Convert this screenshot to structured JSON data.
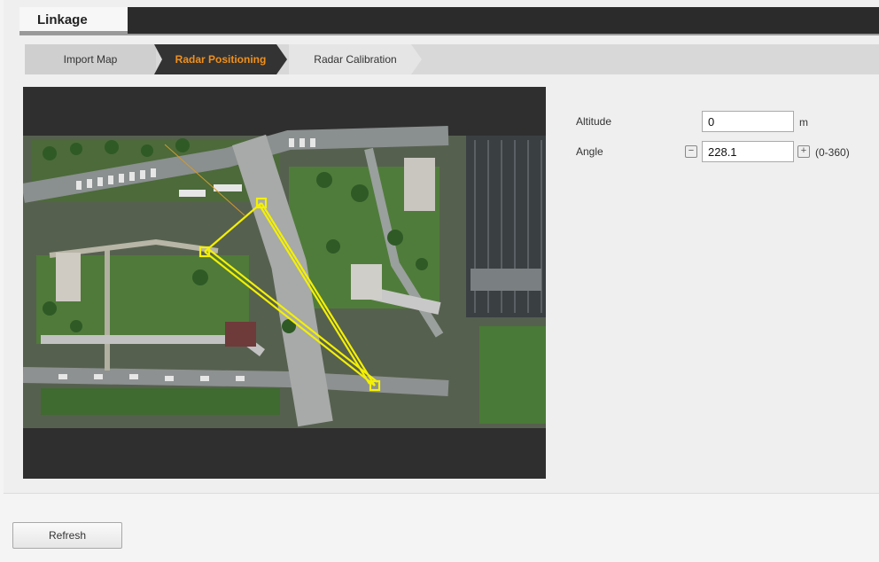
{
  "header": {
    "title": "Linkage"
  },
  "steps": [
    {
      "label": "Import Map"
    },
    {
      "label": "Radar Positioning"
    },
    {
      "label": "Radar Calibration"
    }
  ],
  "form": {
    "altitude_label": "Altitude",
    "altitude_value": "0",
    "altitude_unit": "m",
    "angle_label": "Angle",
    "angle_value": "228.1",
    "angle_minus": "−",
    "angle_plus": "+",
    "angle_range": "(0-360)"
  },
  "footer": {
    "refresh_label": "Refresh"
  },
  "colors": {
    "accent": "#f0901c",
    "radar_marker": "#f4f000"
  }
}
